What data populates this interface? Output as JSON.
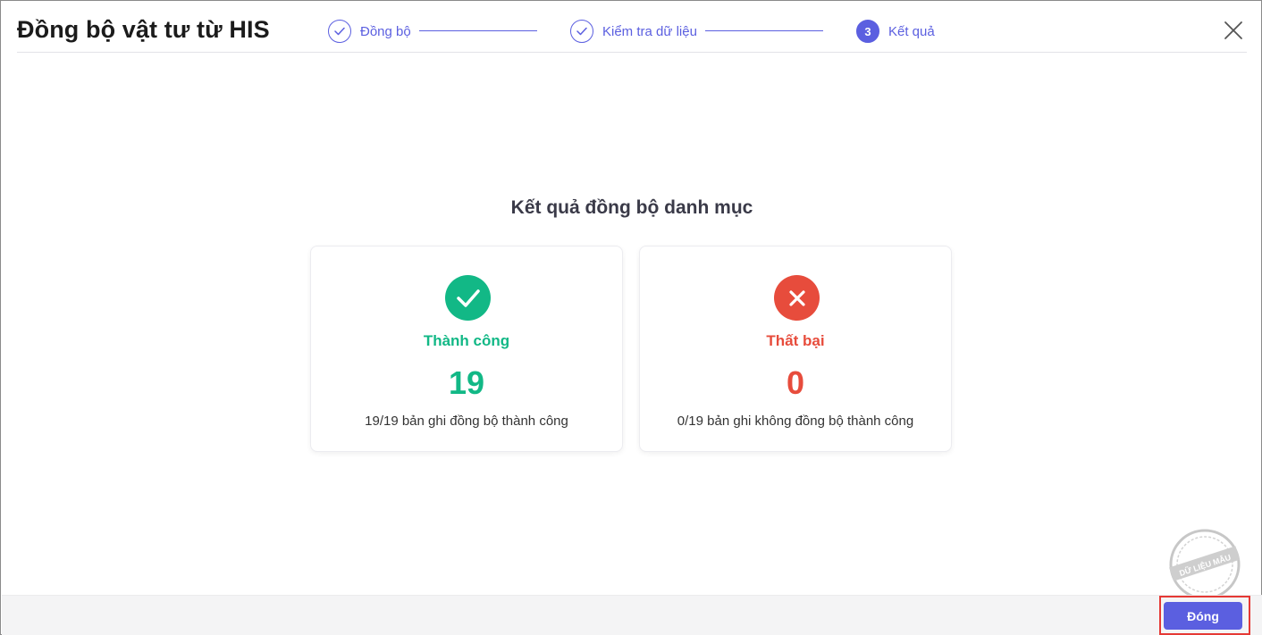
{
  "dialog": {
    "title": "Đồng bộ vật tư từ HIS",
    "close_icon": "close-icon"
  },
  "stepper": {
    "steps": [
      {
        "label": "Đồng bộ",
        "state": "done",
        "icon": "check-icon"
      },
      {
        "label": "Kiểm tra dữ liệu",
        "state": "done",
        "icon": "check-icon"
      },
      {
        "label": "Kết quả",
        "state": "active",
        "number": "3"
      }
    ],
    "accent": "#5b5fe0"
  },
  "result": {
    "title": "Kết quả đồng bộ danh mục",
    "success": {
      "label": "Thành công",
      "count": "19",
      "description": "19/19 bản ghi đồng bộ thành công",
      "icon": "check-circle-icon",
      "color": "#12b886"
    },
    "failure": {
      "label": "Thất bại",
      "count": "0",
      "description": "0/19 bản ghi không đồng bộ thành công",
      "icon": "x-circle-icon",
      "color": "#e74c3c"
    }
  },
  "footer": {
    "close_label": "Đóng"
  },
  "watermark": {
    "text": "DỮ LIỆU MẪU"
  }
}
